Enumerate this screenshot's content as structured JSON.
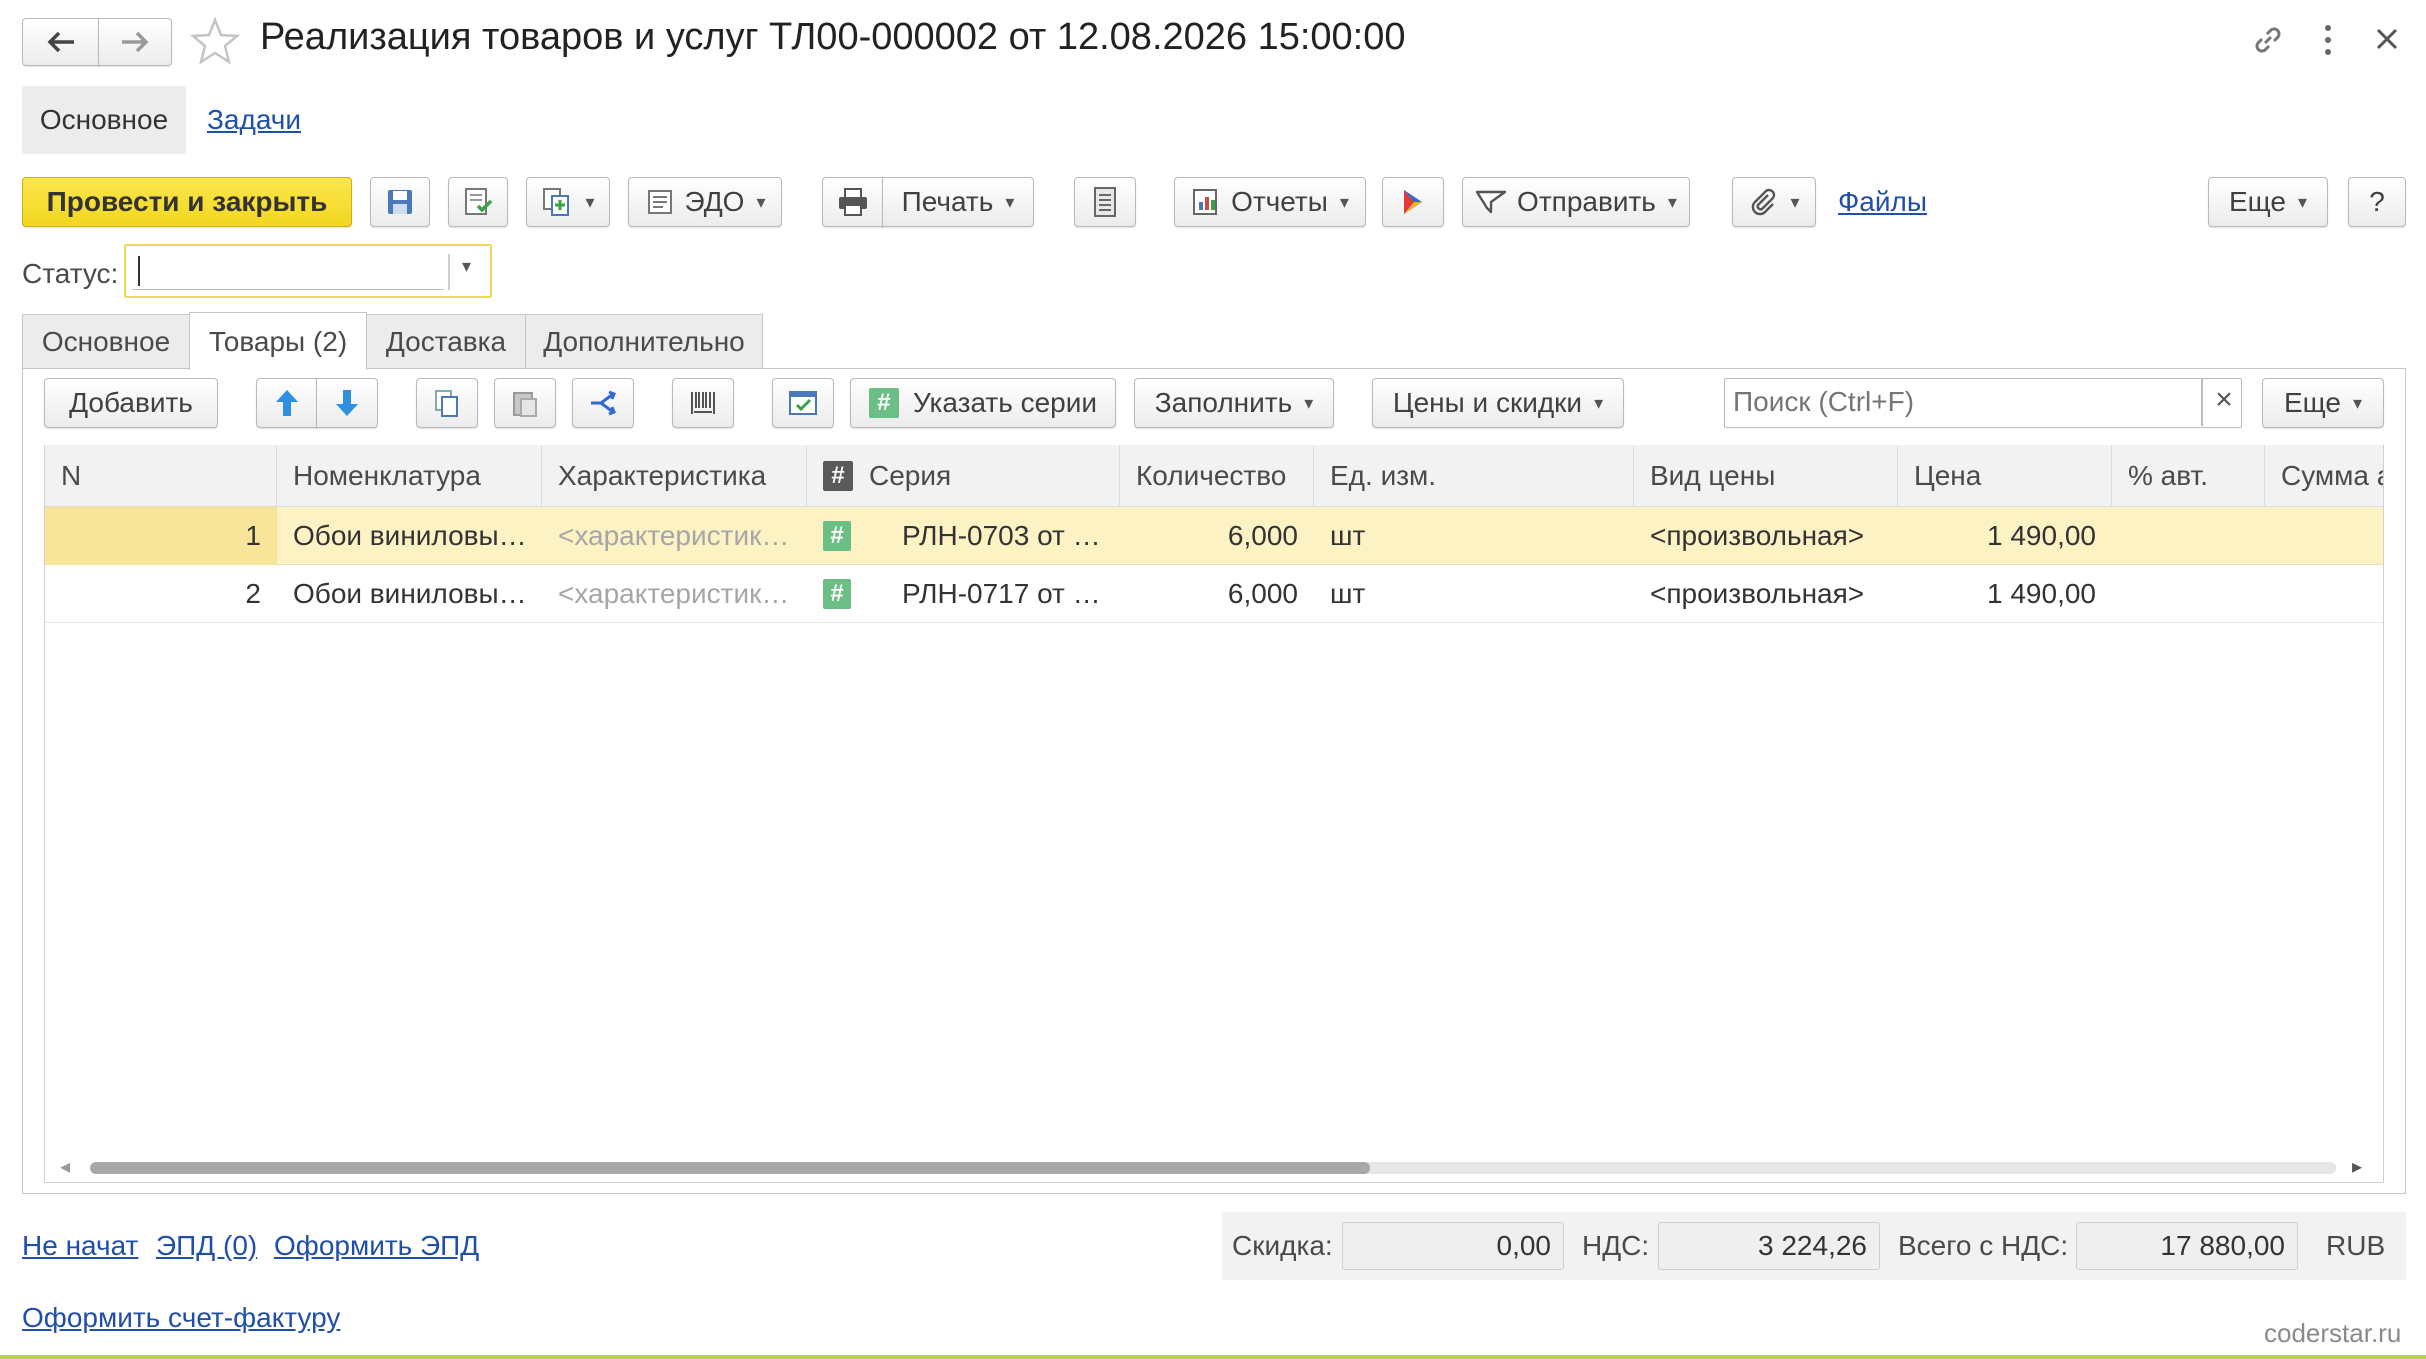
{
  "window": {
    "title": "Реализация товаров и услуг ТЛ00-000002 от 12.08.2026 15:00:00"
  },
  "nav_tabs": {
    "main": "Основное",
    "tasks": "Задачи"
  },
  "toolbar": {
    "post_close": "Провести и закрыть",
    "edo": "ЭДО",
    "print": "Печать",
    "reports": "Отчеты",
    "send": "Отправить",
    "files": "Файлы",
    "more": "Еще",
    "help": "?"
  },
  "status": {
    "label": "Статус:",
    "value": ""
  },
  "doc_tabs": [
    {
      "label": "Основное"
    },
    {
      "label": "Товары (2)"
    },
    {
      "label": "Доставка"
    },
    {
      "label": "Дополнительно"
    }
  ],
  "table_toolbar": {
    "add": "Добавить",
    "series": "Указать серии",
    "fill": "Заполнить",
    "prices": "Цены и скидки",
    "search_placeholder": "Поиск (Ctrl+F)",
    "clear": "×",
    "more": "Еще"
  },
  "table": {
    "columns": [
      "N",
      "Номенклатура",
      "Характеристика",
      "Серия",
      "Количество",
      "Ед. изм.",
      "Вид цены",
      "Цена",
      "% авт.",
      "Сумма а"
    ],
    "series_header_icon": "#",
    "rows": [
      {
        "n": "1",
        "nomenclature": "Обои виниловы…",
        "characteristic": "<характеристик…",
        "series_icon": "#",
        "series": "РЛН-0703 от …",
        "qty": "6,000",
        "unit": "шт",
        "price_type": "<произвольная>",
        "price": "1 490,00",
        "auto_pct": "",
        "sum": ""
      },
      {
        "n": "2",
        "nomenclature": "Обои виниловы…",
        "characteristic": "<характеристик…",
        "series_icon": "#",
        "series": "РЛН-0717 от …",
        "qty": "6,000",
        "unit": "шт",
        "price_type": "<произвольная>",
        "price": "1 490,00",
        "auto_pct": "",
        "sum": ""
      }
    ],
    "scroll_left": "◂",
    "scroll_right": "▸"
  },
  "footer": {
    "not_started": "Не начат",
    "epd": "ЭПД (0)",
    "make_epd": "Оформить ЭПД",
    "make_invoice": "Оформить счет-фактуру",
    "discount_label": "Скидка:",
    "discount_value": "0,00",
    "vat_label": "НДС:",
    "vat_value": "3 224,26",
    "total_label": "Всего с НДС:",
    "total_value": "17 880,00",
    "currency": "RUB"
  },
  "watermark": "coderstar.ru",
  "colors": {
    "accent_yellow": "#f7e13a",
    "selected_row": "#fdf2c4",
    "link": "#1f4fa8"
  }
}
